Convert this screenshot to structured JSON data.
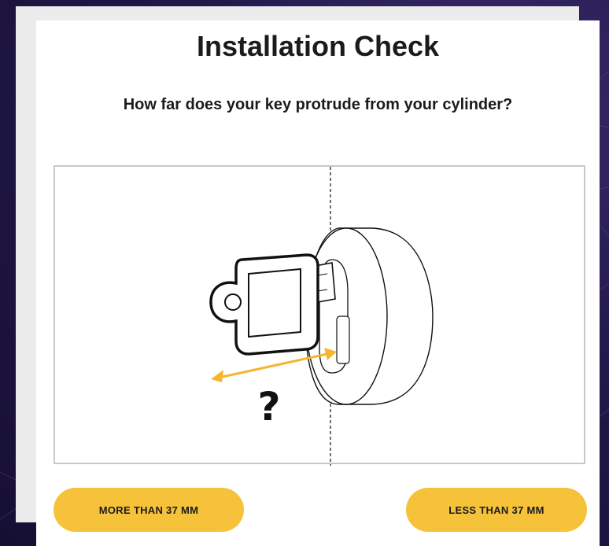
{
  "page": {
    "title": "Installation Check",
    "question": "How far does your key protrude from your cylinder?"
  },
  "illustration": {
    "question_mark": "?",
    "accent_color": "#f5b52e",
    "subject": "key-in-cylinder"
  },
  "buttons": {
    "more_label": "MORE THAN 37 MM",
    "less_label": "LESS THAN 37 MM"
  },
  "colors": {
    "button": "#f5c23a",
    "background": "#22184a",
    "card": "#ffffff"
  }
}
